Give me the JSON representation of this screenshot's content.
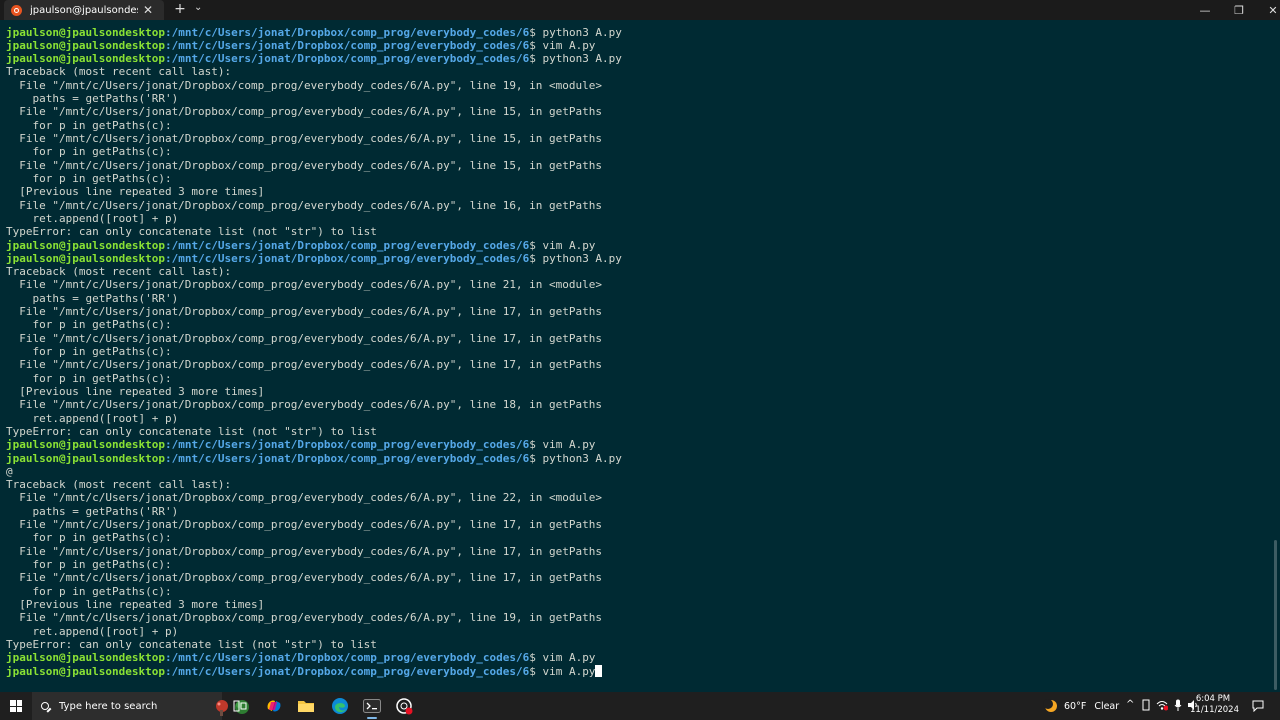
{
  "window": {
    "tab_title": "jpaulson@jpaulsondesktop: /n",
    "tab_close": "✕",
    "new_tab": "+",
    "dropdown": "⌄",
    "minimize": "—",
    "maximize": "❐",
    "close": "✕"
  },
  "prompt": {
    "user": "jpaulson@jpaulsondesktop",
    "path": ":/mnt/c/Users/jonat/Dropbox/comp_prog/everybody_codes/6",
    "sym": "$ "
  },
  "terminal": {
    "lines": [
      {
        "prompt": true,
        "cmd": "python3 A.py"
      },
      {
        "prompt": true,
        "cmd": "vim A.py"
      },
      {
        "prompt": true,
        "cmd": "python3 A.py"
      },
      {
        "text": "Traceback (most recent call last):"
      },
      {
        "text": "  File \"/mnt/c/Users/jonat/Dropbox/comp_prog/everybody_codes/6/A.py\", line 19, in <module>"
      },
      {
        "text": "    paths = getPaths('RR')"
      },
      {
        "text": "  File \"/mnt/c/Users/jonat/Dropbox/comp_prog/everybody_codes/6/A.py\", line 15, in getPaths"
      },
      {
        "text": "    for p in getPaths(c):"
      },
      {
        "text": "  File \"/mnt/c/Users/jonat/Dropbox/comp_prog/everybody_codes/6/A.py\", line 15, in getPaths"
      },
      {
        "text": "    for p in getPaths(c):"
      },
      {
        "text": "  File \"/mnt/c/Users/jonat/Dropbox/comp_prog/everybody_codes/6/A.py\", line 15, in getPaths"
      },
      {
        "text": "    for p in getPaths(c):"
      },
      {
        "text": "  [Previous line repeated 3 more times]"
      },
      {
        "text": "  File \"/mnt/c/Users/jonat/Dropbox/comp_prog/everybody_codes/6/A.py\", line 16, in getPaths"
      },
      {
        "text": "    ret.append([root] + p)"
      },
      {
        "text": "TypeError: can only concatenate list (not \"str\") to list"
      },
      {
        "prompt": true,
        "cmd": "vim A.py"
      },
      {
        "prompt": true,
        "cmd": "python3 A.py"
      },
      {
        "text": "Traceback (most recent call last):"
      },
      {
        "text": "  File \"/mnt/c/Users/jonat/Dropbox/comp_prog/everybody_codes/6/A.py\", line 21, in <module>"
      },
      {
        "text": "    paths = getPaths('RR')"
      },
      {
        "text": "  File \"/mnt/c/Users/jonat/Dropbox/comp_prog/everybody_codes/6/A.py\", line 17, in getPaths"
      },
      {
        "text": "    for p in getPaths(c):"
      },
      {
        "text": "  File \"/mnt/c/Users/jonat/Dropbox/comp_prog/everybody_codes/6/A.py\", line 17, in getPaths"
      },
      {
        "text": "    for p in getPaths(c):"
      },
      {
        "text": "  File \"/mnt/c/Users/jonat/Dropbox/comp_prog/everybody_codes/6/A.py\", line 17, in getPaths"
      },
      {
        "text": "    for p in getPaths(c):"
      },
      {
        "text": "  [Previous line repeated 3 more times]"
      },
      {
        "text": "  File \"/mnt/c/Users/jonat/Dropbox/comp_prog/everybody_codes/6/A.py\", line 18, in getPaths"
      },
      {
        "text": "    ret.append([root] + p)"
      },
      {
        "text": "TypeError: can only concatenate list (not \"str\") to list"
      },
      {
        "prompt": true,
        "cmd": "vim A.py"
      },
      {
        "prompt": true,
        "cmd": "python3 A.py"
      },
      {
        "text": "@"
      },
      {
        "text": "Traceback (most recent call last):"
      },
      {
        "text": "  File \"/mnt/c/Users/jonat/Dropbox/comp_prog/everybody_codes/6/A.py\", line 22, in <module>"
      },
      {
        "text": "    paths = getPaths('RR')"
      },
      {
        "text": "  File \"/mnt/c/Users/jonat/Dropbox/comp_prog/everybody_codes/6/A.py\", line 17, in getPaths"
      },
      {
        "text": "    for p in getPaths(c):"
      },
      {
        "text": "  File \"/mnt/c/Users/jonat/Dropbox/comp_prog/everybody_codes/6/A.py\", line 17, in getPaths"
      },
      {
        "text": "    for p in getPaths(c):"
      },
      {
        "text": "  File \"/mnt/c/Users/jonat/Dropbox/comp_prog/everybody_codes/6/A.py\", line 17, in getPaths"
      },
      {
        "text": "    for p in getPaths(c):"
      },
      {
        "text": "  [Previous line repeated 3 more times]"
      },
      {
        "text": "  File \"/mnt/c/Users/jonat/Dropbox/comp_prog/everybody_codes/6/A.py\", line 19, in getPaths"
      },
      {
        "text": "    ret.append([root] + p)"
      },
      {
        "text": "TypeError: can only concatenate list (not \"str\") to list"
      },
      {
        "prompt": true,
        "cmd": "vim A.py"
      },
      {
        "prompt": true,
        "cmd": "vim A.py",
        "cursor": true
      }
    ]
  },
  "taskbar": {
    "search_placeholder": "Type here to search",
    "weather_temp": "60°F",
    "weather_cond": "Clear",
    "tray_up": "^",
    "time": "6:04 PM",
    "date": "11/11/2024"
  },
  "colors": {
    "terminal_bg": "#002a33",
    "prompt_user": "#8ae234",
    "prompt_path": "#55a8e8",
    "text": "#d3d7cf"
  }
}
